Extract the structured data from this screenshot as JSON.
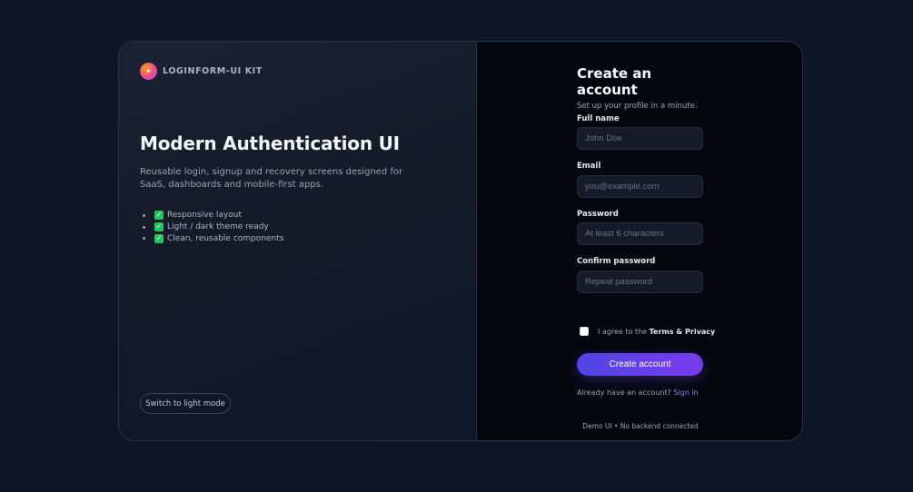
{
  "brand": {
    "logo_glyph": "✦",
    "name": "LOGINFORM-UI KIT"
  },
  "hero": {
    "title": "Modern Authentication UI",
    "subtitle": "Reusable login, signup and recovery screens designed for SaaS, dashboards and mobile-first apps."
  },
  "features": [
    "Responsive layout",
    "Light / dark theme ready",
    "Clean, reusable components"
  ],
  "theme_toggle": {
    "label": "Switch to light mode"
  },
  "form": {
    "title": "Create an account",
    "subtitle": "Set up your profile in a minute.",
    "fields": [
      {
        "label": "Full name",
        "placeholder": "John Doe",
        "value": ""
      },
      {
        "label": "Email",
        "placeholder": "you@example.com",
        "value": ""
      },
      {
        "label": "Password",
        "placeholder": "At least 6 characters",
        "value": ""
      },
      {
        "label": "Confirm password",
        "placeholder": "Repeat password",
        "value": ""
      }
    ],
    "agree": {
      "prefix": "I agree to the ",
      "link": "Terms & Privacy",
      "checked": false
    },
    "submit_label": "Create account",
    "signin_prompt": "Already have an account?",
    "signin_link": "Sign in",
    "footnote": "Demo UI • No backend connected"
  },
  "colors": {
    "accent": "#4f46e5",
    "accent_end": "#7c3aed",
    "link": "#818cf8",
    "check": "#22c55e"
  },
  "icons": {
    "brand": "sparkle-logo-icon",
    "feature_bullet": "check-square-icon"
  }
}
